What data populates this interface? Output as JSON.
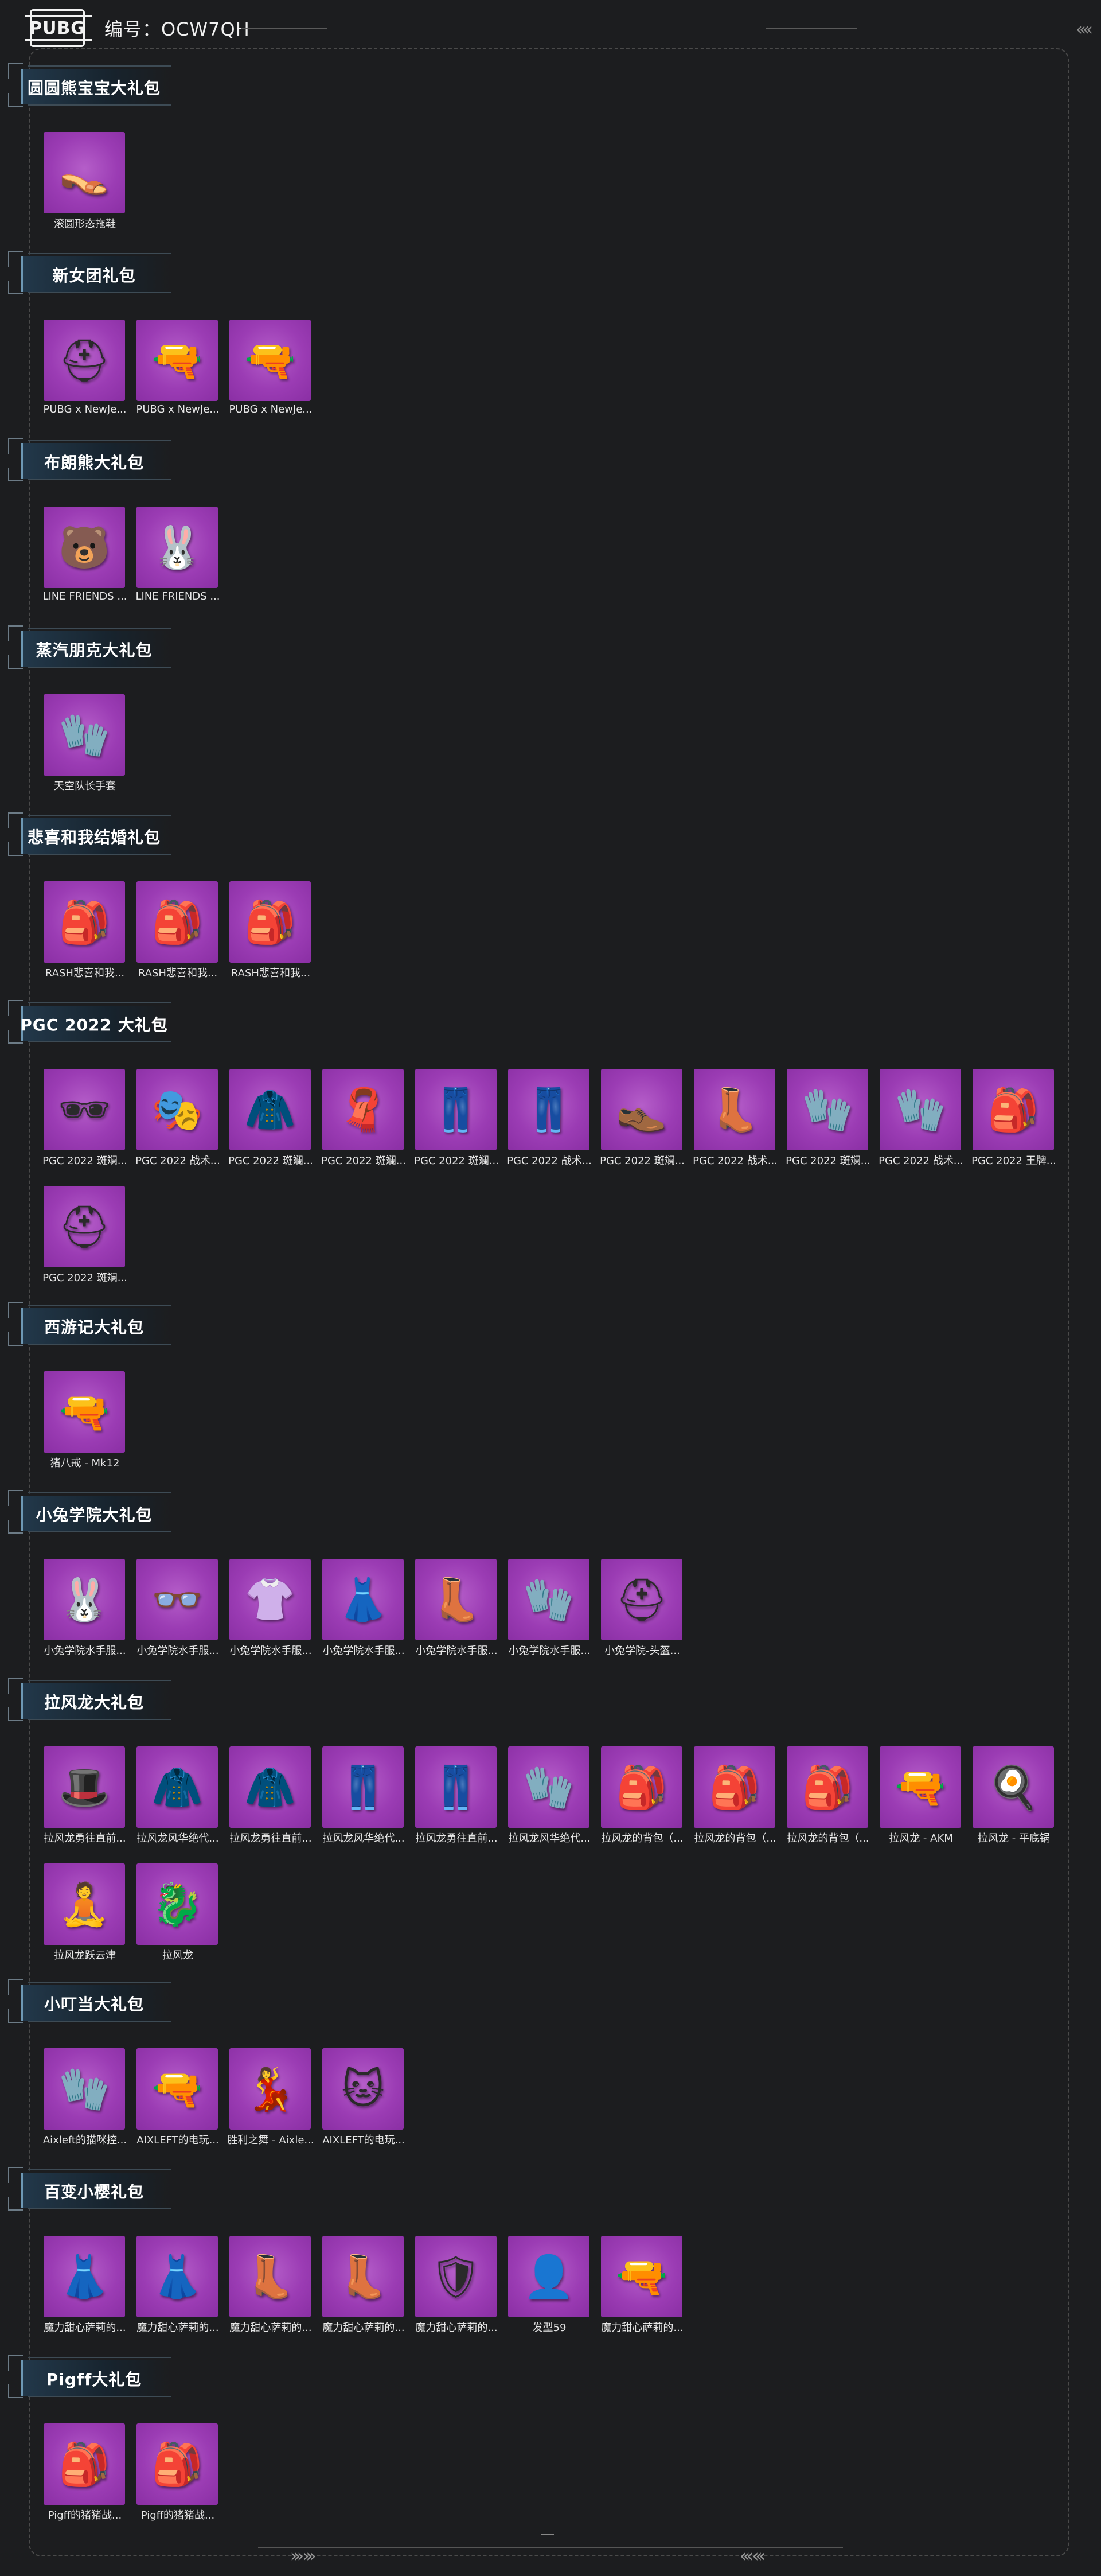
{
  "header": {
    "logo": "PUBG",
    "code": "编号：OCW7QH"
  },
  "colors": {
    "background": "#1c1d1f",
    "tile": "#9b3cb4",
    "section_accent": "#22384a"
  },
  "sections": [
    {
      "title": "圆圆熊宝宝大礼包",
      "items": [
        {
          "label": "滚圆形态拖鞋",
          "icon": "slippers-icon",
          "glyph": "👡"
        }
      ]
    },
    {
      "title": "新女团礼包",
      "items": [
        {
          "label": "PUBG x NewJe...",
          "icon": "helmet-icon",
          "glyph": "⛑"
        },
        {
          "label": "PUBG x NewJe...",
          "icon": "rifle-icon",
          "glyph": "🔫"
        },
        {
          "label": "PUBG x NewJe...",
          "icon": "rifle-icon",
          "glyph": "🔫"
        }
      ]
    },
    {
      "title": "布朗熊大礼包",
      "items": [
        {
          "label": "LINE FRIENDS ...",
          "icon": "brown-bear-icon",
          "glyph": "🐻"
        },
        {
          "label": "LINE FRIENDS ...",
          "icon": "cony-bunny-icon",
          "glyph": "🐰"
        }
      ]
    },
    {
      "title": "蒸汽朋克大礼包",
      "items": [
        {
          "label": "天空队长手套",
          "icon": "glove-icon",
          "glyph": "🧤"
        }
      ]
    },
    {
      "title": "悲喜和我结婚礼包",
      "items": [
        {
          "label": "RASH悲喜和我...",
          "icon": "backpack-icon",
          "glyph": "🎒"
        },
        {
          "label": "RASH悲喜和我...",
          "icon": "backpack-icon",
          "glyph": "🎒"
        },
        {
          "label": "RASH悲喜和我...",
          "icon": "backpack-icon",
          "glyph": "🎒"
        }
      ]
    },
    {
      "title": "PGC 2022 大礼包",
      "items": [
        {
          "label": "PGC 2022 斑斓...",
          "icon": "sunglasses-icon",
          "glyph": "🕶"
        },
        {
          "label": "PGC 2022 战术...",
          "icon": "mask-icon",
          "glyph": "🎭"
        },
        {
          "label": "PGC 2022 斑斓...",
          "icon": "jacket-icon",
          "glyph": "🧥"
        },
        {
          "label": "PGC 2022 斑斓...",
          "icon": "scarf-icon",
          "glyph": "🧣"
        },
        {
          "label": "PGC 2022 斑斓...",
          "icon": "pants-icon",
          "glyph": "👖"
        },
        {
          "label": "PGC 2022 战术...",
          "icon": "pants-icon",
          "glyph": "👖"
        },
        {
          "label": "PGC 2022 斑斓...",
          "icon": "shoes-icon",
          "glyph": "👞"
        },
        {
          "label": "PGC 2022 战术...",
          "icon": "boots-icon",
          "glyph": "👢"
        },
        {
          "label": "PGC 2022 斑斓...",
          "icon": "glove-icon",
          "glyph": "🧤"
        },
        {
          "label": "PGC 2022 战术...",
          "icon": "glove-icon",
          "glyph": "🧤"
        },
        {
          "label": "PGC 2022 王牌...",
          "icon": "backpack-icon",
          "glyph": "🎒"
        },
        {
          "label": "PGC 2022 斑斓...",
          "icon": "helmet-icon",
          "glyph": "⛑"
        }
      ]
    },
    {
      "title": "西游记大礼包",
      "items": [
        {
          "label": "猪八戒 - Mk12",
          "icon": "rifle-icon",
          "glyph": "🔫"
        }
      ]
    },
    {
      "title": "小兔学院大礼包",
      "items": [
        {
          "label": "小兔学院水手服...",
          "icon": "bunny-hat-icon",
          "glyph": "🐰"
        },
        {
          "label": "小兔学院水手服...",
          "icon": "glasses-icon",
          "glyph": "👓"
        },
        {
          "label": "小兔学院水手服...",
          "icon": "shirt-icon",
          "glyph": "👚"
        },
        {
          "label": "小兔学院水手服...",
          "icon": "skirt-icon",
          "glyph": "👗"
        },
        {
          "label": "小兔学院水手服...",
          "icon": "boots-icon",
          "glyph": "👢"
        },
        {
          "label": "小兔学院水手服...",
          "icon": "glove-icon",
          "glyph": "🧤"
        },
        {
          "label": "小兔学院-头盔...",
          "icon": "helmet-icon",
          "glyph": "⛑"
        }
      ]
    },
    {
      "title": "拉风龙大礼包",
      "items": [
        {
          "label": "拉风龙勇往直前...",
          "icon": "hat-icon",
          "glyph": "🎩"
        },
        {
          "label": "拉风龙风华绝代...",
          "icon": "jacket-icon",
          "glyph": "🧥"
        },
        {
          "label": "拉风龙勇往直前...",
          "icon": "jacket-icon",
          "glyph": "🧥"
        },
        {
          "label": "拉风龙风华绝代...",
          "icon": "pants-icon",
          "glyph": "👖"
        },
        {
          "label": "拉风龙勇往直前...",
          "icon": "pants-icon",
          "glyph": "👖"
        },
        {
          "label": "拉风龙风华绝代...",
          "icon": "glove-icon",
          "glyph": "🧤"
        },
        {
          "label": "拉风龙的背包（...",
          "icon": "backpack-icon",
          "glyph": "🎒"
        },
        {
          "label": "拉风龙的背包（...",
          "icon": "backpack-icon",
          "glyph": "🎒"
        },
        {
          "label": "拉风龙的背包（...",
          "icon": "backpack-icon",
          "glyph": "🎒"
        },
        {
          "label": "拉风龙 - AKM",
          "icon": "rifle-icon",
          "glyph": "🔫"
        },
        {
          "label": "拉风龙 - 平底锅",
          "icon": "pan-icon",
          "glyph": "🍳"
        },
        {
          "label": "拉风龙跃云津",
          "icon": "emote-icon",
          "glyph": "🧘"
        },
        {
          "label": "拉风龙",
          "icon": "dragon-icon",
          "glyph": "🐉"
        }
      ]
    },
    {
      "title": "小叮当大礼包",
      "items": [
        {
          "label": "Aixleft的猫咪控...",
          "icon": "glove-icon",
          "glyph": "🧤"
        },
        {
          "label": "AIXLEFT的电玩...",
          "icon": "rifle-icon",
          "glyph": "🔫"
        },
        {
          "label": "胜利之舞 - Aixle...",
          "icon": "emote-icon",
          "glyph": "💃"
        },
        {
          "label": "AIXLEFT的电玩...",
          "icon": "badge-icon",
          "glyph": "🐱"
        }
      ]
    },
    {
      "title": "百变小樱礼包",
      "items": [
        {
          "label": "魔力甜心萨莉的...",
          "icon": "dress-icon",
          "glyph": "👗"
        },
        {
          "label": "魔力甜心萨莉的...",
          "icon": "dress-icon",
          "glyph": "👗"
        },
        {
          "label": "魔力甜心萨莉的...",
          "icon": "boots-icon",
          "glyph": "👢"
        },
        {
          "label": "魔力甜心萨莉的...",
          "icon": "boots-icon",
          "glyph": "👢"
        },
        {
          "label": "魔力甜心萨莉的...",
          "icon": "winged-shield-icon",
          "glyph": "🛡"
        },
        {
          "label": "发型59",
          "icon": "hairstyle-icon",
          "glyph": "👤"
        },
        {
          "label": "魔力甜心萨莉的...",
          "icon": "rifle-icon",
          "glyph": "🔫"
        }
      ]
    },
    {
      "title": "Pigff大礼包",
      "items": [
        {
          "label": "Pigff的猪猪战...",
          "icon": "backpack-icon",
          "glyph": "🎒"
        },
        {
          "label": "Pigff的猪猪战...",
          "icon": "backpack-icon",
          "glyph": "🎒"
        }
      ]
    }
  ]
}
